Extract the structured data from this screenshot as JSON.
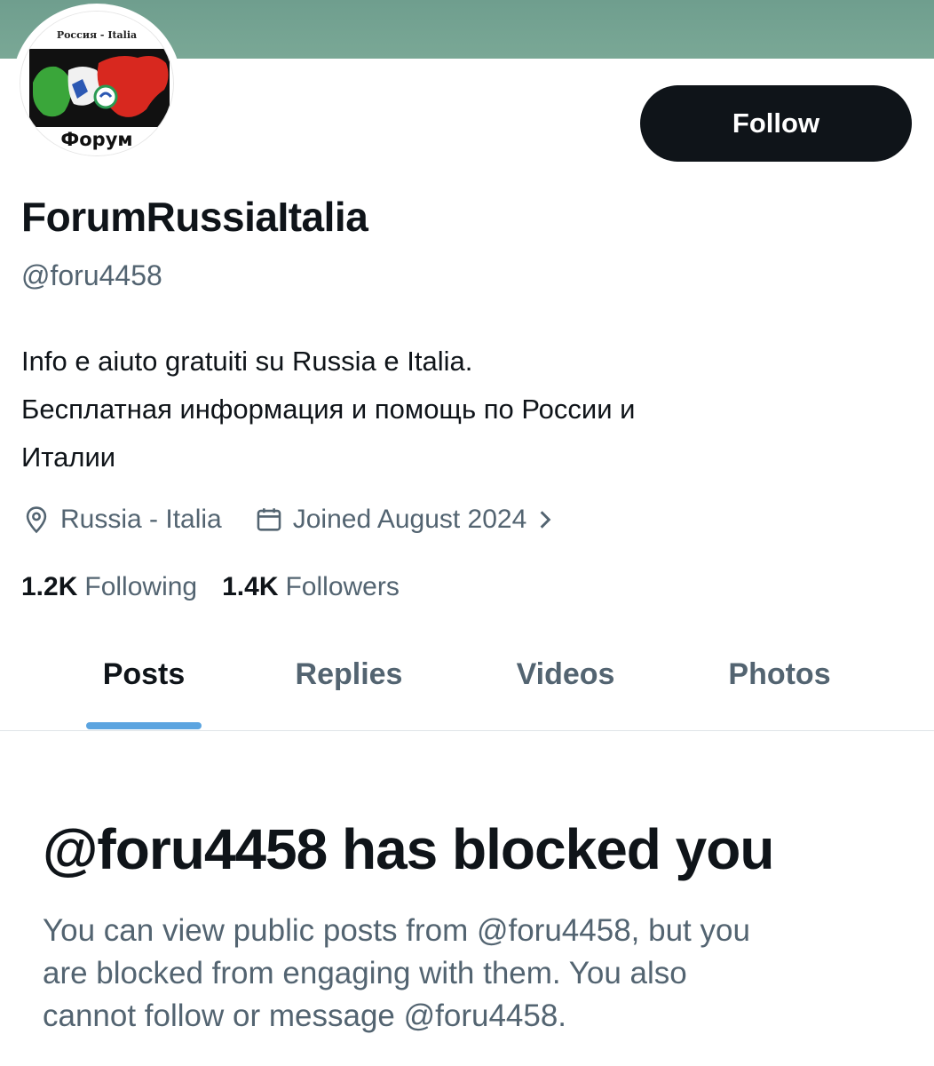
{
  "profile": {
    "avatar_top_text": "Россия - Italia",
    "avatar_bottom_text": "Форум",
    "display_name": "ForumRussiaItalia",
    "handle": "@foru4458",
    "bio_lines": [
      "Info e aiuto gratuiti su Russia e Italia.",
      "Бесплатная информация и помощь по России и",
      "Италии"
    ],
    "location": "Russia - Italia",
    "joined": "Joined August 2024",
    "following_count": "1.2K",
    "following_label": "Following",
    "followers_count": "1.4K",
    "followers_label": "Followers"
  },
  "actions": {
    "follow_label": "Follow"
  },
  "tabs": [
    {
      "label": "Posts",
      "active": true
    },
    {
      "label": "Replies",
      "active": false
    },
    {
      "label": "Videos",
      "active": false
    },
    {
      "label": "Photos",
      "active": false
    }
  ],
  "blocked": {
    "title": "@foru4458 has blocked you",
    "message_lines": [
      "You can view public posts from @foru4458, but you",
      "are blocked from engaging with them. You also",
      "cannot follow or message @foru4458."
    ]
  },
  "colors": {
    "banner": "#7aa896",
    "button": "#0f1419",
    "secondary_text": "#536471",
    "tab_indicator": "#5ba4e0"
  },
  "icons": {
    "location": "location-pin-icon",
    "calendar": "calendar-icon",
    "chevron": "chevron-right-icon"
  }
}
